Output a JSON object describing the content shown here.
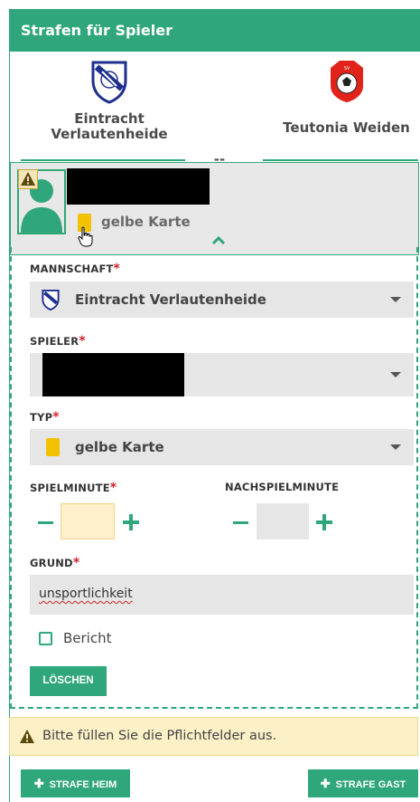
{
  "header": {
    "title": "Strafen für Spieler"
  },
  "teams": {
    "home": {
      "name_line1": "Eintracht",
      "name_line2": "Verlautenheide"
    },
    "away": {
      "name": "Teutonia Weiden"
    },
    "score": "--"
  },
  "player_card": {
    "card_type_label": "gelbe Karte",
    "card_color": "#f2c200"
  },
  "form": {
    "mannschaft": {
      "label": "MANNSCHAFT",
      "required_mark": "*",
      "value": "Eintracht Verlautenheide"
    },
    "spieler": {
      "label": "SPIELER",
      "required_mark": "*"
    },
    "typ": {
      "label": "TYP",
      "required_mark": "*",
      "value": "gelbe Karte"
    },
    "spielminute": {
      "label": "SPIELMINUTE",
      "required_mark": "*",
      "value": ""
    },
    "nachspielminute": {
      "label": "NACHSPIELMINUTE",
      "value": ""
    },
    "grund": {
      "label": "GRUND",
      "required_mark": "*",
      "value": "unsportlichkeit"
    },
    "bericht": {
      "label": "Bericht",
      "checked": false
    },
    "delete_button": "LÖSCHEN"
  },
  "alert": {
    "text": "Bitte füllen Sie die Pflichtfelder aus."
  },
  "buttons": {
    "add_home": "STRAFE HEIM",
    "add_away": "STRAFE GAST"
  },
  "colors": {
    "accent": "#2fa77a",
    "required": "#d2232a",
    "alert_bg": "#fbf0c6"
  }
}
